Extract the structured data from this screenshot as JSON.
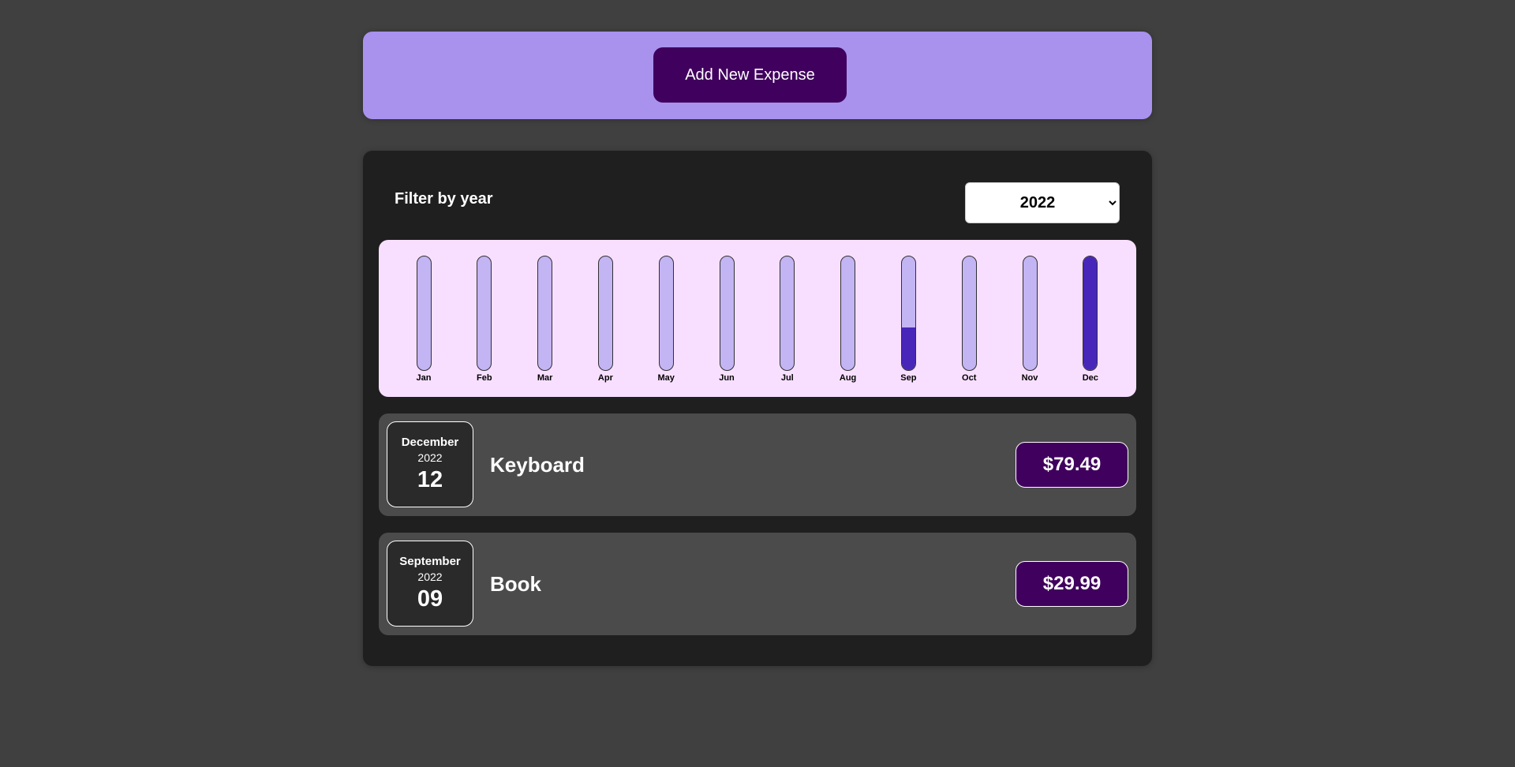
{
  "new_expense": {
    "add_label": "Add New Expense"
  },
  "filter": {
    "label": "Filter by year",
    "selected_year": "2022"
  },
  "chart_data": {
    "type": "bar",
    "categories": [
      "Jan",
      "Feb",
      "Mar",
      "Apr",
      "May",
      "Jun",
      "Jul",
      "Aug",
      "Sep",
      "Oct",
      "Nov",
      "Dec"
    ],
    "values": [
      0,
      0,
      0,
      0,
      0,
      0,
      0,
      0,
      29.99,
      0,
      0,
      79.49
    ],
    "ylim": [
      0,
      79.49
    ],
    "colors": {
      "track": "#c3b4f3",
      "fill": "#4826b9"
    }
  },
  "expenses": [
    {
      "month": "December",
      "year": "2022",
      "day": "12",
      "title": "Keyboard",
      "amount": "$79.49"
    },
    {
      "month": "September",
      "year": "2022",
      "day": "09",
      "title": "Book",
      "amount": "$29.99"
    }
  ]
}
